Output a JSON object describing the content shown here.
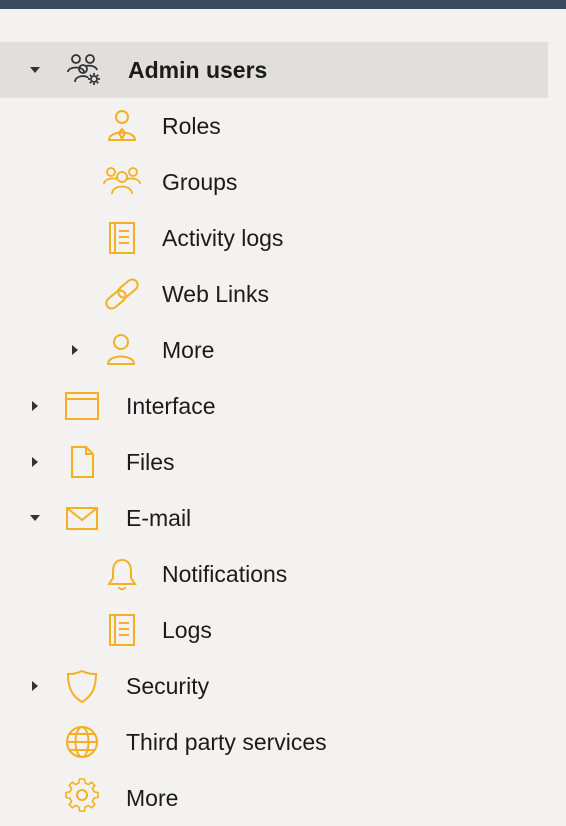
{
  "tree": {
    "admin_users": {
      "label": "Admin users",
      "icon": "users-gear-icon",
      "expanded": true,
      "selected": true
    },
    "roles": {
      "label": "Roles",
      "icon": "user-tie-icon"
    },
    "groups": {
      "label": "Groups",
      "icon": "group-icon"
    },
    "activity_logs": {
      "label": "Activity logs",
      "icon": "log-book-icon"
    },
    "web_links": {
      "label": "Web Links",
      "icon": "link-icon"
    },
    "more_users": {
      "label": "More",
      "icon": "user-icon",
      "expanded": false
    },
    "interface": {
      "label": "Interface",
      "icon": "window-icon",
      "expanded": false
    },
    "files": {
      "label": "Files",
      "icon": "file-icon",
      "expanded": false
    },
    "email": {
      "label": "E-mail",
      "icon": "envelope-icon",
      "expanded": true
    },
    "notifications": {
      "label": "Notifications",
      "icon": "bell-icon"
    },
    "logs": {
      "label": "Logs",
      "icon": "log-book-icon"
    },
    "security": {
      "label": "Security",
      "icon": "shield-icon",
      "expanded": false
    },
    "third_party": {
      "label": "Third party services",
      "icon": "globe-icon"
    },
    "more": {
      "label": "More",
      "icon": "gear-icon"
    }
  },
  "colors": {
    "accent": "#f5b021",
    "selected_background": "#e0dfde",
    "background": "#f3f2f1",
    "top_bar": "#3a4b60",
    "text": "#1b1b1b"
  }
}
